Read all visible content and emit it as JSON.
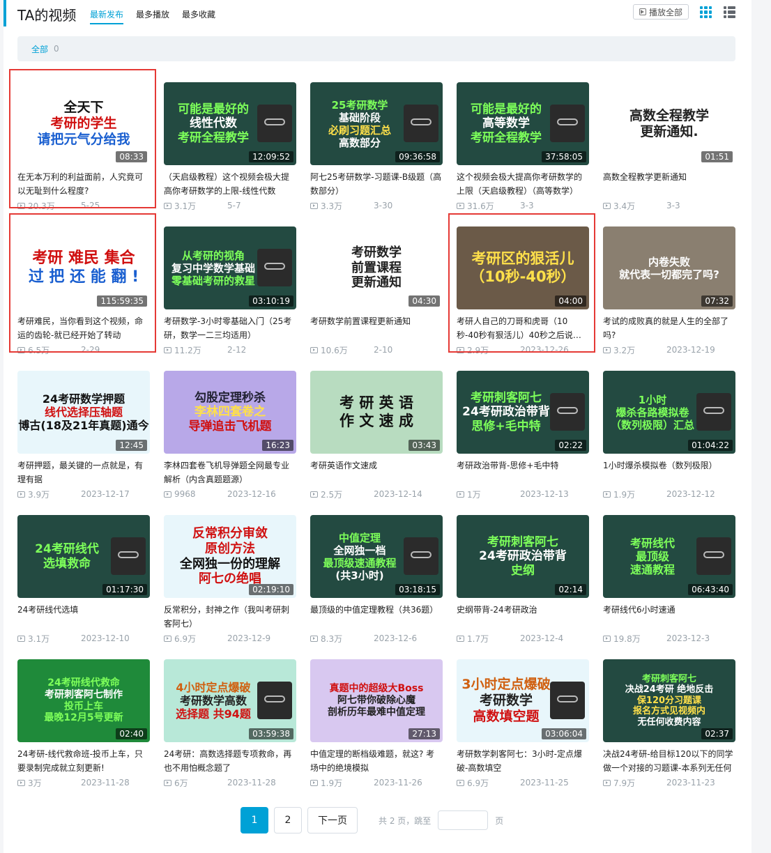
{
  "header": {
    "title": "TA的视频",
    "tabs": [
      "最新发布",
      "最多播放",
      "最多收藏"
    ],
    "active_tab": 0,
    "play_all_label": "播放全部"
  },
  "filter": {
    "label": "全部",
    "count": "0"
  },
  "colors": {
    "accent": "#00a1d6",
    "highlight_box": "#e53935",
    "dark_green": "#234a41"
  },
  "videos": [
    {
      "title": "在无本万利的利益面前，人究竟可以无耻到什么程度?",
      "views": "20.3万",
      "date": "5-25",
      "duration": "08:33",
      "thumb_lines": [
        "全天下",
        "考研的学生",
        "请把元气分给我"
      ],
      "highlighted": true
    },
    {
      "title": "（天启级教程）这个视频会极大提高你考研数学的上限-线性代数",
      "views": "3.1万",
      "date": "5-7",
      "duration": "12:09:52",
      "thumb_lines": [
        "可能是最好的",
        "线性代数",
        "考研全程教学"
      ]
    },
    {
      "title": "阿七25考研数学-习题课-B级题（高数部分）",
      "views": "3.3万",
      "date": "3-30",
      "duration": "09:36:58",
      "thumb_lines": [
        "25考研数学",
        "基础阶段",
        "必刷习题汇总",
        "高数部分"
      ]
    },
    {
      "title": "这个视频会极大提高你考研数学的上限（天启级教程）（高等数学）",
      "views": "31.6万",
      "date": "3-3",
      "duration": "37:58:05",
      "thumb_lines": [
        "可能是最好的",
        "高等数学",
        "考研全程教学"
      ]
    },
    {
      "title": "高数全程教学更新通知",
      "views": "3.4万",
      "date": "3-3",
      "duration": "01:51",
      "thumb_lines": [
        "高数全程教学",
        "更新通知."
      ]
    },
    {
      "title": "考研难民，当你看到这个视频，命运的齿轮-就已经开始了转动",
      "views": "6.5万",
      "date": "2-29",
      "duration": "115:59:35",
      "thumb_lines": [
        "考研 难民 集合",
        "过 把 还 能 翻 !"
      ],
      "highlighted": true
    },
    {
      "title": "考研数学-3小时零基础入门（25考研，数学一二三均适用）",
      "views": "11.2万",
      "date": "2-12",
      "duration": "03:10:19",
      "thumb_lines": [
        "从考研的视角",
        "复习中学数学基础",
        "零基础考研的救星"
      ]
    },
    {
      "title": "考研数学前置课程更新通知",
      "views": "10.6万",
      "date": "2-10",
      "duration": "04:30",
      "thumb_lines": [
        "考研数学",
        "前置课程",
        "更新通知"
      ]
    },
    {
      "title": "考研人自己的刀哥和虎哥（10秒-40秒有狠活儿）40秒之后说正事儿",
      "views": "2.9万",
      "date": "2023-12-26",
      "duration": "04:00",
      "thumb_lines": [
        "考研区的狠活儿",
        "（10秒-40秒）"
      ],
      "highlighted": true
    },
    {
      "title": "考试的成败真的就是人生的全部了吗?",
      "views": "3.2万",
      "date": "2023-12-19",
      "duration": "07:32",
      "thumb_lines": [
        "内卷失败",
        "就代表一切都完了吗?"
      ]
    },
    {
      "title": "考研押题，最关键的一点就是，有理有据",
      "views": "3.9万",
      "date": "2023-12-17",
      "duration": "12:45",
      "thumb_lines": [
        "24考研数学押题",
        "线代选择压轴题",
        "博古(18及21年真题)通今"
      ]
    },
    {
      "title": "李林四套卷飞机导弹题全网最专业解析（内含真题题源）",
      "views": "9968",
      "date": "2023-12-16",
      "duration": "16:23",
      "thumb_lines": [
        "勾股定理秒杀",
        "李林四套卷之",
        "导弹追击飞机题"
      ]
    },
    {
      "title": "考研英语作文速成",
      "views": "2.5万",
      "date": "2023-12-14",
      "duration": "03:43",
      "thumb_lines": [
        "考 研 英 语",
        "作 文 速 成"
      ]
    },
    {
      "title": "考研政治带背-思修+毛中特",
      "views": "1万",
      "date": "2023-12-13",
      "duration": "02:22",
      "thumb_lines": [
        "考研刺客阿七",
        "24考研政治带背",
        "思修+毛中特"
      ]
    },
    {
      "title": "1小时爆杀模拟卷（数列极限）",
      "views": "1.9万",
      "date": "2023-12-12",
      "duration": "01:04:22",
      "thumb_lines": [
        "1小时",
        "爆杀各路模拟卷",
        "（数列极限）汇总"
      ]
    },
    {
      "title": "24考研线代选填",
      "views": "3.1万",
      "date": "2023-12-10",
      "duration": "01:17:30",
      "thumb_lines": [
        "24考研线代",
        "选填救命"
      ]
    },
    {
      "title": "反常积分，封神之作（我叫考研刺客阿七）",
      "views": "6.9万",
      "date": "2023-12-9",
      "duration": "02:19:10",
      "thumb_lines": [
        "反常积分审敛",
        "原创方法",
        "全网独一份的理解",
        "阿七の绝唱"
      ]
    },
    {
      "title": "最顶级的中值定理教程（共36题）",
      "views": "8.3万",
      "date": "2023-12-6",
      "duration": "03:18:15",
      "thumb_lines": [
        "中值定理",
        "全网独一档",
        "最顶级速通教程",
        "(共3小时)"
      ]
    },
    {
      "title": "史纲带背-24考研政治",
      "views": "1.7万",
      "date": "2023-12-4",
      "duration": "02:14",
      "thumb_lines": [
        "考研刺客阿七",
        "24考研政治带背",
        "史纲"
      ]
    },
    {
      "title": "考研线代6小时速通",
      "views": "19.8万",
      "date": "2023-12-3",
      "duration": "06:43:40",
      "thumb_lines": [
        "考研线代",
        "最顶级",
        "速通教程"
      ]
    },
    {
      "title": "24考研-线代救命班-投币上车，只要录制完成就立刻更新!",
      "views": "3万",
      "date": "2023-11-28",
      "duration": "02:40",
      "thumb_lines": [
        "24考研线代救命",
        "考研刺客阿七制作",
        "投币上车",
        "最晚12月5号更新"
      ]
    },
    {
      "title": "24考研：高数选择题专项救命，再也不用怕概念题了",
      "views": "6万",
      "date": "2023-11-28",
      "duration": "03:59:38",
      "thumb_lines": [
        "4小时定点爆破",
        "考研数学高数",
        "选择题 共94题"
      ]
    },
    {
      "title": "中值定理的断档级难题，就这? 考场中的绝境模拟",
      "views": "1.9万",
      "date": "2023-11-26",
      "duration": "27:13",
      "thumb_lines": [
        "真题中的超级大Boss",
        "阿七带你破除心魔",
        "剖析历年最难中值定理"
      ]
    },
    {
      "title": "考研数学刺客阿七：3小时-定点爆破-高数填空",
      "views": "6.9万",
      "date": "2023-11-25",
      "duration": "03:06:04",
      "thumb_lines": [
        "3小时定点爆破",
        "考研数学",
        "高数填空题"
      ]
    },
    {
      "title": "决战24考研-给目标120以下的同学做一个对接的习题课-本系列无任何",
      "views": "7.9万",
      "date": "2023-11-23",
      "duration": "02:37",
      "thumb_lines": [
        "考研刺客阿七",
        "决战24考研 绝地反击",
        "保120分习题课",
        "报名方式见视频内",
        "无任何收费内容"
      ]
    }
  ],
  "pagination": {
    "pages": [
      "1",
      "2"
    ],
    "current": "1",
    "next_label": "下一页",
    "info_prefix": "共 2 页，跳至",
    "info_suffix": "页"
  }
}
